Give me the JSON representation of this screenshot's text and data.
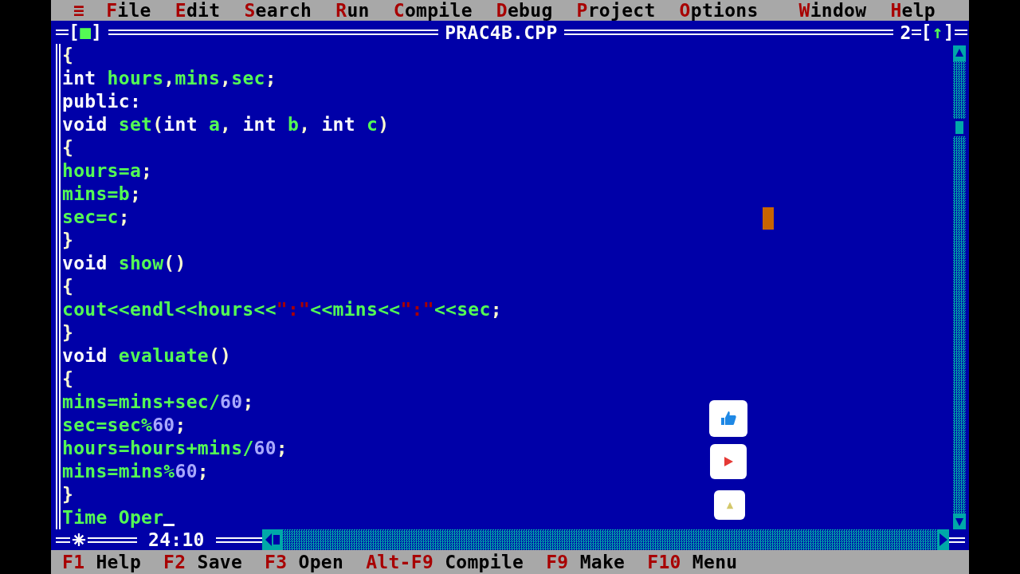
{
  "menu_bar": {
    "system_menu": "≡",
    "items": [
      {
        "label": "File"
      },
      {
        "label": "Edit"
      },
      {
        "label": "Search"
      },
      {
        "label": "Run"
      },
      {
        "label": "Compile"
      },
      {
        "label": "Debug"
      },
      {
        "label": "Project"
      },
      {
        "label": "Options"
      }
    ],
    "right_items": [
      {
        "label": "Window"
      },
      {
        "label": "Help"
      }
    ]
  },
  "editor": {
    "close_box": "[■]",
    "title": "PRAC4B.CPP",
    "window_number": "2",
    "zoom_box": "[↑]",
    "lines": [
      {
        "tokens": [
          {
            "kind": "p",
            "t": "{"
          }
        ]
      },
      {
        "tokens": [
          {
            "kind": "kw",
            "t": "int "
          },
          {
            "kind": "id",
            "t": "hours"
          },
          {
            "kind": "p",
            "t": ","
          },
          {
            "kind": "id",
            "t": "mins"
          },
          {
            "kind": "p",
            "t": ","
          },
          {
            "kind": "id",
            "t": "sec"
          },
          {
            "kind": "p",
            "t": ";"
          }
        ]
      },
      {
        "tokens": [
          {
            "kind": "kw",
            "t": "public:"
          }
        ]
      },
      {
        "tokens": [
          {
            "kind": "kw",
            "t": "void "
          },
          {
            "kind": "id",
            "t": "set"
          },
          {
            "kind": "p",
            "t": "("
          },
          {
            "kind": "kw",
            "t": "int "
          },
          {
            "kind": "id",
            "t": "a"
          },
          {
            "kind": "p",
            "t": ", "
          },
          {
            "kind": "kw",
            "t": "int "
          },
          {
            "kind": "id",
            "t": "b"
          },
          {
            "kind": "p",
            "t": ", "
          },
          {
            "kind": "kw",
            "t": "int "
          },
          {
            "kind": "id",
            "t": "c"
          },
          {
            "kind": "p",
            "t": ")"
          }
        ]
      },
      {
        "tokens": [
          {
            "kind": "p",
            "t": "{"
          }
        ]
      },
      {
        "tokens": [
          {
            "kind": "id",
            "t": "hours"
          },
          {
            "kind": "op",
            "t": "="
          },
          {
            "kind": "id",
            "t": "a"
          },
          {
            "kind": "p",
            "t": ";"
          }
        ]
      },
      {
        "tokens": [
          {
            "kind": "id",
            "t": "mins"
          },
          {
            "kind": "op",
            "t": "="
          },
          {
            "kind": "id",
            "t": "b"
          },
          {
            "kind": "p",
            "t": ";"
          }
        ]
      },
      {
        "tokens": [
          {
            "kind": "id",
            "t": "sec"
          },
          {
            "kind": "op",
            "t": "="
          },
          {
            "kind": "id",
            "t": "c"
          },
          {
            "kind": "p",
            "t": ";"
          }
        ]
      },
      {
        "tokens": [
          {
            "kind": "p",
            "t": "}"
          }
        ]
      },
      {
        "tokens": [
          {
            "kind": "kw",
            "t": "void "
          },
          {
            "kind": "id",
            "t": "show"
          },
          {
            "kind": "p",
            "t": "()"
          }
        ]
      },
      {
        "tokens": [
          {
            "kind": "p",
            "t": "{"
          }
        ]
      },
      {
        "tokens": [
          {
            "kind": "id",
            "t": "cout"
          },
          {
            "kind": "op",
            "t": "<<"
          },
          {
            "kind": "id",
            "t": "endl"
          },
          {
            "kind": "op",
            "t": "<<"
          },
          {
            "kind": "id",
            "t": "hours"
          },
          {
            "kind": "op",
            "t": "<<"
          },
          {
            "kind": "str",
            "t": "\":\""
          },
          {
            "kind": "op",
            "t": "<<"
          },
          {
            "kind": "id",
            "t": "mins"
          },
          {
            "kind": "op",
            "t": "<<"
          },
          {
            "kind": "str",
            "t": "\":\""
          },
          {
            "kind": "op",
            "t": "<<"
          },
          {
            "kind": "id",
            "t": "sec"
          },
          {
            "kind": "p",
            "t": ";"
          }
        ]
      },
      {
        "tokens": [
          {
            "kind": "p",
            "t": "}"
          }
        ]
      },
      {
        "tokens": [
          {
            "kind": "kw",
            "t": "void "
          },
          {
            "kind": "id",
            "t": "evaluate"
          },
          {
            "kind": "p",
            "t": "()"
          }
        ]
      },
      {
        "tokens": [
          {
            "kind": "p",
            "t": "{"
          }
        ]
      },
      {
        "tokens": [
          {
            "kind": "id",
            "t": "mins"
          },
          {
            "kind": "op",
            "t": "="
          },
          {
            "kind": "id",
            "t": "mins"
          },
          {
            "kind": "op",
            "t": "+"
          },
          {
            "kind": "id",
            "t": "sec"
          },
          {
            "kind": "op",
            "t": "/"
          },
          {
            "kind": "num",
            "t": "60"
          },
          {
            "kind": "p",
            "t": ";"
          }
        ]
      },
      {
        "tokens": [
          {
            "kind": "id",
            "t": "sec"
          },
          {
            "kind": "op",
            "t": "="
          },
          {
            "kind": "id",
            "t": "sec"
          },
          {
            "kind": "op",
            "t": "%"
          },
          {
            "kind": "num",
            "t": "60"
          },
          {
            "kind": "p",
            "t": ";"
          }
        ]
      },
      {
        "tokens": [
          {
            "kind": "id",
            "t": "hours"
          },
          {
            "kind": "op",
            "t": "="
          },
          {
            "kind": "id",
            "t": "hours"
          },
          {
            "kind": "op",
            "t": "+"
          },
          {
            "kind": "id",
            "t": "mins"
          },
          {
            "kind": "op",
            "t": "/"
          },
          {
            "kind": "num",
            "t": "60"
          },
          {
            "kind": "p",
            "t": ";"
          }
        ]
      },
      {
        "tokens": [
          {
            "kind": "id",
            "t": "mins"
          },
          {
            "kind": "op",
            "t": "="
          },
          {
            "kind": "id",
            "t": "mins"
          },
          {
            "kind": "op",
            "t": "%"
          },
          {
            "kind": "num",
            "t": "60"
          },
          {
            "kind": "p",
            "t": ";"
          }
        ]
      },
      {
        "tokens": [
          {
            "kind": "p",
            "t": "}"
          }
        ]
      },
      {
        "tokens": [
          {
            "kind": "id",
            "t": "Time Oper"
          }
        ],
        "caret": true
      }
    ],
    "modified": true,
    "cursor_position": "24:10"
  },
  "mouse_cursor": true,
  "overlay_buttons": [
    {
      "kind": "like"
    },
    {
      "kind": "play"
    },
    {
      "kind": "triangle"
    }
  ],
  "help_bar": [
    {
      "key": "F1",
      "label": "Help"
    },
    {
      "key": "F2",
      "label": "Save"
    },
    {
      "key": "F3",
      "label": "Open"
    },
    {
      "key": "Alt-F9",
      "label": "Compile"
    },
    {
      "key": "F9",
      "label": "Make"
    },
    {
      "key": "F10",
      "label": "Menu"
    }
  ]
}
